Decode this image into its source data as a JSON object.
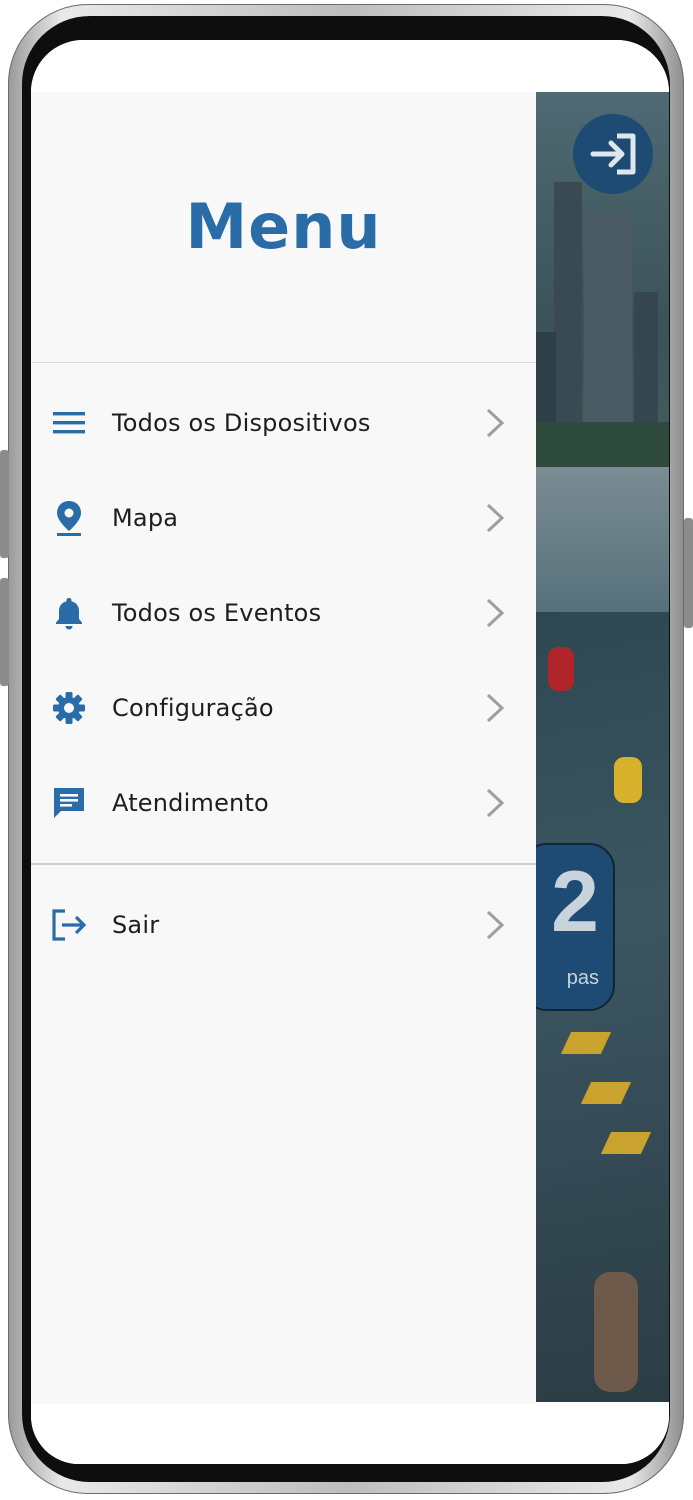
{
  "drawer": {
    "title": "Menu",
    "items": [
      {
        "label": "Todos os Dispositivos",
        "icon": "list-icon"
      },
      {
        "label": "Mapa",
        "icon": "map-pin-icon"
      },
      {
        "label": "Todos os Eventos",
        "icon": "bell-icon"
      },
      {
        "label": "Configuração",
        "icon": "gear-icon"
      },
      {
        "label": "Atendimento",
        "icon": "chat-icon"
      }
    ],
    "logout": {
      "label": "Sair",
      "icon": "logout-icon"
    }
  },
  "background_app": {
    "stat_number": "2",
    "stat_label": "pas",
    "login_icon": "login-icon"
  },
  "colors": {
    "accent": "#2a6ca8",
    "drawer_bg": "#f8f8f8",
    "text": "#1e1e1e",
    "chevron": "#9e9e9e",
    "fab_bg": "#1e4b73"
  }
}
